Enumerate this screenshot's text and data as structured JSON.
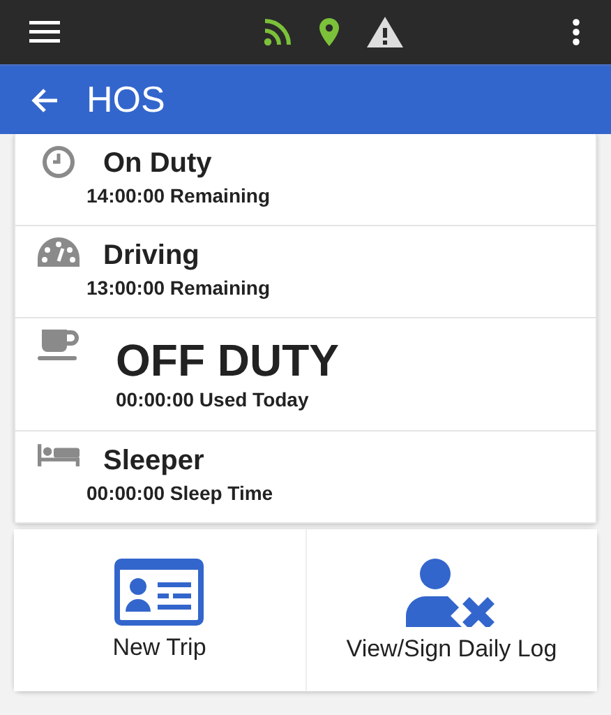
{
  "app_bar": {
    "title": "HOS"
  },
  "statuses": [
    {
      "kind": "clock",
      "title": "On Duty",
      "detail": "14:00:00 Remaining",
      "selected": false
    },
    {
      "kind": "gauge",
      "title": "Driving",
      "detail": "13:00:00 Remaining",
      "selected": false
    },
    {
      "kind": "cup",
      "title": "OFF DUTY",
      "detail": "00:00:00 Used Today",
      "selected": true
    },
    {
      "kind": "bed",
      "title": "Sleeper",
      "detail": "00:00:00 Sleep Time",
      "selected": false
    }
  ],
  "actions": [
    {
      "kind": "card",
      "label": "New Trip"
    },
    {
      "kind": "user-x",
      "label": "View/Sign Daily Log"
    }
  ]
}
